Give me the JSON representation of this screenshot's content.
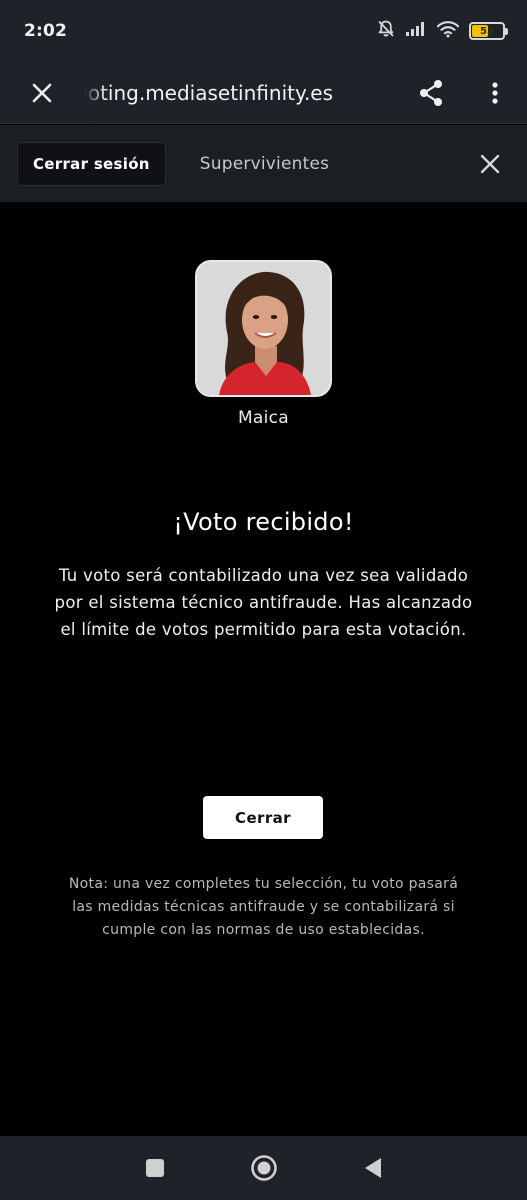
{
  "status_bar": {
    "time": "2:02",
    "battery_level": "53",
    "battery_fraction": 0.53,
    "icons": [
      "bell-muted-icon",
      "signal-icon",
      "wifi-icon",
      "battery-icon"
    ]
  },
  "browser": {
    "url": "voting.mediasetinfinity.es",
    "icons": [
      "close-icon",
      "share-icon",
      "more-vert-icon"
    ]
  },
  "tab": {
    "logout_label": "Cerrar sesión",
    "title": "Supervivientes",
    "icons": [
      "close-icon"
    ]
  },
  "candidate": {
    "name": "Maica"
  },
  "confirmation": {
    "title": "¡Voto recibido!",
    "message": "Tu voto será contabilizado una vez sea validado por el sistema técnico antifraude. Has alcanzado el límite de votos permitido para esta votación.",
    "close_label": "Cerrar",
    "note": "Nota: una vez completes tu selección, tu voto pasará las medidas técnicas antifraude y se contabilizará si cumple con las normas de uso establecidas."
  },
  "nav_bar": {
    "icons": [
      "recents-icon",
      "home-icon",
      "back-icon"
    ]
  },
  "colors": {
    "bar_bg": "#1f2329",
    "content_bg": "#000000",
    "battery_accent": "#f2c200",
    "button_bg": "#ffffff"
  }
}
